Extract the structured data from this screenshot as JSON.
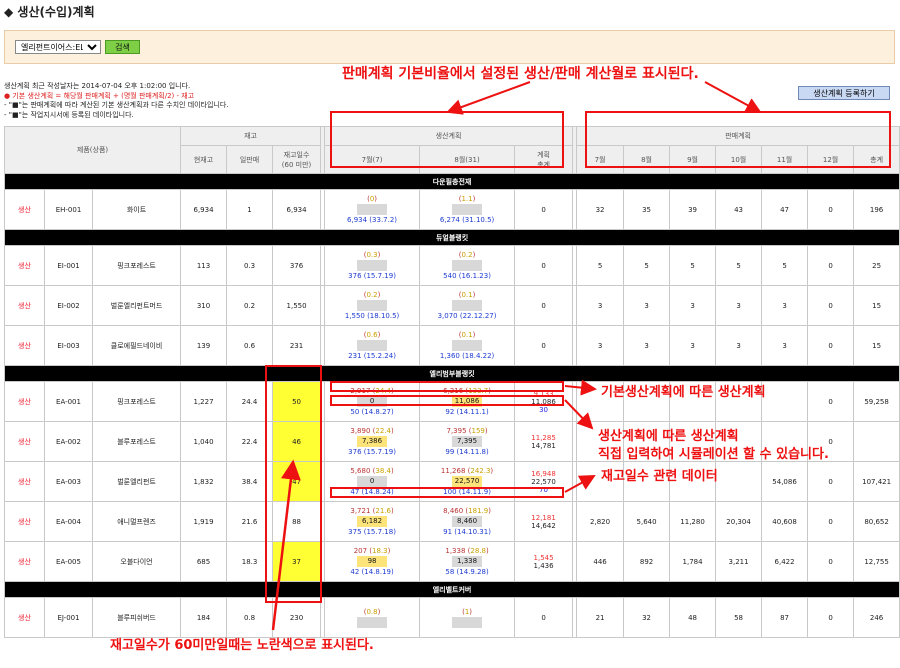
{
  "title": "◆ 생산(수입)계획",
  "filter": {
    "company_value": "엘리펀트이어스:EL",
    "search_label": "검색"
  },
  "notes": {
    "line1": "생산계획 최근 작성날자는 2014-07-04 오후 1:02:00 입니다.",
    "line2": "● 기본 생산계획 = 해당월 판매계획 + (명월 판매계획/2) - 재고",
    "line3": "- \"■\"는 판매계획에 따라 계산된 기본 생산계획과 다른 수치인 데이타입니다.",
    "line4": "- \"■\"는 작업지시서에 등록된 데이타입니다."
  },
  "register_label": "생산계획 등록하기",
  "headers": {
    "product": "제품(상품)",
    "stock": "재고",
    "cur": "현재고",
    "daily": "일판매",
    "days": "재고일수\n(60 미만)",
    "plan": "생산계획",
    "jul": "7월(7)",
    "aug": "8월(31)",
    "ptotal": "계획\n총계",
    "sales": "판매계획",
    "m7": "7월",
    "m8": "8월",
    "m9": "9월",
    "m10": "10월",
    "m11": "11월",
    "m12": "12월",
    "stotal": "총계"
  },
  "groups": [
    {
      "name": "다운필충전재",
      "rows": [
        {
          "kind": "생산",
          "code": "EH-001",
          "name": "화이트",
          "stock": "6,934",
          "daily": "1",
          "days": "6,934",
          "hl": false,
          "p7": {
            "top": "(",
            "paren": "0",
            "close": ")",
            "inp": "",
            "y": false,
            "bot": "6,934 (33.7.2)"
          },
          "p8": {
            "top": "(",
            "paren": "1.1",
            "close": ")",
            "inp": "",
            "y": false,
            "bot": "6,274 (31.10.5)"
          },
          "tot": {
            "a": "",
            "b": "0",
            "c": ""
          },
          "sales": [
            "32",
            "35",
            "39",
            "43",
            "47",
            "0",
            "196"
          ]
        }
      ]
    },
    {
      "name": "듀얼블랭킷",
      "rows": [
        {
          "kind": "생산",
          "code": "EI-001",
          "name": "핑크포레스트",
          "stock": "113",
          "daily": "0.3",
          "days": "376",
          "hl": false,
          "p7": {
            "top": "(",
            "paren": "0.3",
            "close": ")",
            "inp": "",
            "y": false,
            "bot": "376 (15.7.19)"
          },
          "p8": {
            "top": "(",
            "paren": "0.2",
            "close": ")",
            "inp": "",
            "y": false,
            "bot": "540 (16.1.23)"
          },
          "tot": {
            "a": "",
            "b": "0",
            "c": ""
          },
          "sales": [
            "5",
            "5",
            "5",
            "5",
            "5",
            "0",
            "25"
          ]
        },
        {
          "kind": "생산",
          "code": "EI-002",
          "name": "벌룬엘리펀트머드",
          "stock": "310",
          "daily": "0.2",
          "days": "1,550",
          "hl": false,
          "p7": {
            "top": "(",
            "paren": "0.2",
            "close": ")",
            "inp": "",
            "y": false,
            "bot": "1,550 (18.10.5)"
          },
          "p8": {
            "top": "(",
            "paren": "0.1",
            "close": ")",
            "inp": "",
            "y": false,
            "bot": "3,070 (22.12.27)"
          },
          "tot": {
            "a": "",
            "b": "0",
            "c": ""
          },
          "sales": [
            "3",
            "3",
            "3",
            "3",
            "3",
            "0",
            "15"
          ]
        },
        {
          "kind": "생산",
          "code": "EI-003",
          "name": "클로에필드네이비",
          "stock": "139",
          "daily": "0.6",
          "days": "231",
          "hl": false,
          "p7": {
            "top": "(",
            "paren": "0.6",
            "close": ")",
            "inp": "",
            "y": false,
            "bot": "231 (15.2.24)"
          },
          "p8": {
            "top": "(",
            "paren": "0.1",
            "close": ")",
            "inp": "",
            "y": false,
            "bot": "1,360 (18.4.22)"
          },
          "tot": {
            "a": "",
            "b": "0",
            "c": ""
          },
          "sales": [
            "3",
            "3",
            "3",
            "3",
            "3",
            "0",
            "15"
          ]
        }
      ]
    },
    {
      "name": "엘리범부블랭킷",
      "rows": [
        {
          "kind": "생산",
          "code": "EA-001",
          "name": "핑크포레스트",
          "stock": "1,227",
          "daily": "24.4",
          "days": "50",
          "hl": true,
          "p7": {
            "top": "2,917 (",
            "paren": "24.4",
            "close": ")",
            "inp": "0",
            "y": false,
            "bot": "50 (14.8.27)"
          },
          "p8": {
            "top": "6,216 (",
            "paren": "133.7",
            "close": ")",
            "inp": "11,086",
            "y": true,
            "bot": "92 (14.11.1)"
          },
          "tot": {
            "a": "9,133",
            "b": "11,086",
            "c": "30"
          },
          "sales": [
            "",
            "",
            "",
            "",
            "",
            "0",
            "59,258"
          ]
        },
        {
          "kind": "생산",
          "code": "EA-002",
          "name": "블루포레스트",
          "stock": "1,040",
          "daily": "22.4",
          "days": "46",
          "hl": true,
          "p7": {
            "top": "3,890 (",
            "paren": "22.4",
            "close": ")",
            "inp": "7,386",
            "y": true,
            "bot": "376 (15.7.19)"
          },
          "p8": {
            "top": "7,395 (",
            "paren": "159",
            "close": ")",
            "inp": "7,395",
            "y": false,
            "bot": "99 (14.11.8)"
          },
          "tot": {
            "a": "11,285",
            "b": "14,781",
            "c": ""
          },
          "sales": [
            "",
            "",
            "",
            "",
            "",
            "0",
            ""
          ]
        },
        {
          "kind": "생산",
          "code": "EA-003",
          "name": "벌룬엘리펀트",
          "stock": "1,832",
          "daily": "38.4",
          "days": "47",
          "hl": true,
          "p7": {
            "top": "5,680 (",
            "paren": "38.4",
            "close": ")",
            "inp": "0",
            "y": false,
            "bot": "47 (14.8.24)"
          },
          "p8": {
            "top": "11,268 (",
            "paren": "242.3",
            "close": ")",
            "inp": "22,570",
            "y": true,
            "bot": "100 (14.11.9)"
          },
          "tot": {
            "a": "16,948",
            "b": "22,570",
            "c": "70"
          },
          "sales": [
            "",
            "",
            "",
            "",
            "54,086",
            "0",
            "107,421"
          ]
        },
        {
          "kind": "생산",
          "code": "EA-004",
          "name": "애니멀프렌즈",
          "stock": "1,919",
          "daily": "21.6",
          "days": "88",
          "hl": false,
          "p7": {
            "top": "3,721 (",
            "paren": "21.6",
            "close": ")",
            "inp": "6,182",
            "y": true,
            "bot": "375 (15.7.18)"
          },
          "p8": {
            "top": "8,460 (",
            "paren": "181.9",
            "close": ")",
            "inp": "8,460",
            "y": false,
            "bot": "91 (14.10.31)"
          },
          "tot": {
            "a": "12,181",
            "b": "14,642",
            "c": ""
          },
          "sales": [
            "2,820",
            "5,640",
            "11,280",
            "20,304",
            "40,608",
            "0",
            "80,652"
          ]
        },
        {
          "kind": "생산",
          "code": "EA-005",
          "name": "오블다이언",
          "stock": "685",
          "daily": "18.3",
          "days": "37",
          "hl": true,
          "p7": {
            "top": "207 (",
            "paren": "18.3",
            "close": ")",
            "inp": "98",
            "y": true,
            "bot": "42 (14.8.19)"
          },
          "p8": {
            "top": "1,338 (",
            "paren": "28.8",
            "close": ")",
            "inp": "1,338",
            "y": false,
            "bot": "58 (14.9.28)"
          },
          "tot": {
            "a": "1,545",
            "b": "1,436",
            "c": ""
          },
          "sales": [
            "446",
            "892",
            "1,784",
            "3,211",
            "6,422",
            "0",
            "12,755"
          ]
        }
      ]
    },
    {
      "name": "엘리벨트커버",
      "rows": [
        {
          "kind": "생산",
          "code": "EJ-001",
          "name": "블루피쉬버드",
          "stock": "184",
          "daily": "0.8",
          "days": "230",
          "hl": false,
          "p7": {
            "top": "(",
            "paren": "0.8",
            "close": ")",
            "inp": "",
            "y": false,
            "bot": ""
          },
          "p8": {
            "top": "(",
            "paren": "1",
            "close": ")",
            "inp": "",
            "y": false,
            "bot": ""
          },
          "tot": {
            "a": "",
            "b": "0",
            "c": ""
          },
          "sales": [
            "21",
            "32",
            "48",
            "58",
            "87",
            "0",
            "246"
          ]
        }
      ]
    }
  ],
  "annotations": {
    "a1": "판매계획 기본비율에서 설정된 생산/판매 계산월로 표시된다.",
    "a2": "기본생산계획에 따른 생산계획",
    "a3": "생산계획에 따른 생산계획",
    "a4": "직접 입력하여 시뮬레이션 할 수 있습니다.",
    "a5": "재고일수 관련 데이터",
    "a6": "재고일수가 60미만일때는 노란색으로 표시된다."
  },
  "colors": {
    "accent": "#e11111",
    "group_bg": "#000000",
    "highlight": "#ffff33",
    "button": "#7fcf46"
  }
}
